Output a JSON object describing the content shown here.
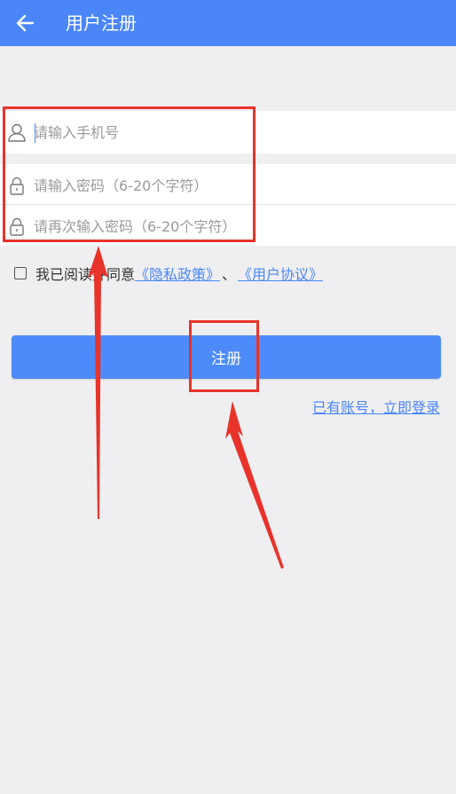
{
  "appbar": {
    "title": "用户注册"
  },
  "form": {
    "phone_placeholder": "请输入手机号",
    "password_placeholder": "请输入密码（6-20个字符）",
    "confirm_placeholder": "请再次输入密码（6-20个字符）"
  },
  "agreement": {
    "text": "我已阅读并同意",
    "privacy_link": "《隐私政策》",
    "separator": "、",
    "user_agreement_link": "《用户协议》",
    "checked": false
  },
  "buttons": {
    "register_label": "注册",
    "login_link": "已有账号，立即登录"
  },
  "colors": {
    "primary": "#4a86f7",
    "button": "#4d8bfa",
    "background": "#efeff1",
    "annotation": "#e8332a"
  }
}
